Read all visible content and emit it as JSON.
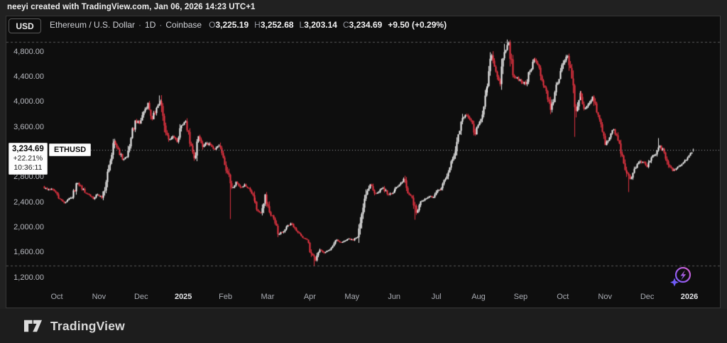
{
  "attribution": {
    "text": "neeyi created with TradingView.com, Jan 06, 2026 14:23 UTC+1"
  },
  "toolbar": {
    "currency_button": "USD"
  },
  "legend": {
    "symbol_title": "Ethereum / U.S. Dollar",
    "sep": "·",
    "interval": "1D",
    "exchange": "Coinbase",
    "ohlc": [
      {
        "label": "O",
        "value": "3,225.19"
      },
      {
        "label": "H",
        "value": "3,252.68"
      },
      {
        "label": "L",
        "value": "3,203.14"
      },
      {
        "label": "C",
        "value": "3,234.69"
      }
    ],
    "change": "+9.50 (+0.29%)"
  },
  "price_tag": {
    "price": "3,234.69",
    "change_percent": "+22.21%",
    "countdown": "10:36:11",
    "symbol": "ETHUSD"
  },
  "footer": {
    "brand": "TradingView"
  },
  "icons": {
    "bottom_right": "lightning-boost-icon",
    "footer_left": "tradingview-logo-icon"
  },
  "colors": {
    "up": "#ffffff",
    "down": "#f23645",
    "pane_bg": "#0e0e0e",
    "pane_border": "#363636",
    "level_line": "rgba(150,150,152,0.55)",
    "price_line": "rgba(185,185,190,0.85)",
    "accent_purple": "#7a5cff",
    "accent_magenta": "#c157c1"
  },
  "chart_data": {
    "type": "candlestick",
    "symbol": "ETHUSD",
    "interval": "1D",
    "exchange": "Coinbase",
    "x_axis": {
      "labels": [
        "Oct",
        "Nov",
        "Dec",
        "2025",
        "Feb",
        "Mar",
        "Apr",
        "May",
        "Jun",
        "Jul",
        "Aug",
        "Sep",
        "Oct",
        "Nov",
        "Dec",
        "2026"
      ]
    },
    "y_axis": {
      "ticks": [
        {
          "value": 4800,
          "label": "4,800.00"
        },
        {
          "value": 4400,
          "label": "4,400.00"
        },
        {
          "value": 4000,
          "label": "4,000.00"
        },
        {
          "value": 3600,
          "label": "3,600.00"
        },
        {
          "value": 2800,
          "label": "2,800.00"
        },
        {
          "value": 2400,
          "label": "2,400.00"
        },
        {
          "value": 2000,
          "label": "2,000.00"
        },
        {
          "value": 1600,
          "label": "1,600.00"
        },
        {
          "value": 1200,
          "label": "1,200.00"
        }
      ],
      "hidden_tick_behind_label": 3200
    },
    "levels": {
      "high_dashed_line": 4955,
      "low_dashed_line": 1385,
      "last_price_line": 3234.69
    },
    "last": {
      "open": 3225.19,
      "high": 3252.68,
      "low": 3203.14,
      "close": 3234.69,
      "change": 9.5,
      "change_pct": 0.29
    },
    "points_per_month": 10,
    "close_path": [
      2650,
      2600,
      2610,
      2560,
      2450,
      2390,
      2440,
      2470,
      2700,
      2660,
      2550,
      2520,
      2450,
      2520,
      2470,
      2720,
      3060,
      3370,
      3240,
      3080,
      3120,
      3420,
      3700,
      3650,
      3840,
      3980,
      3720,
      3900,
      4010,
      3620,
      3400,
      3450,
      3360,
      3620,
      3690,
      3330,
      3100,
      3450,
      3280,
      3340,
      3310,
      3240,
      3300,
      3110,
      2870,
      2630,
      2720,
      2640,
      2680,
      2620,
      2510,
      2280,
      2230,
      2520,
      2240,
      2140,
      1890,
      1920,
      2010,
      2060,
      1980,
      1900,
      1830,
      1800,
      1580,
      1470,
      1640,
      1590,
      1630,
      1700,
      1800,
      1760,
      1790,
      1820,
      1790,
      1840,
      2210,
      2520,
      2680,
      2540,
      2560,
      2630,
      2530,
      2530,
      2620,
      2680,
      2770,
      2540,
      2470,
      2230,
      2410,
      2450,
      2490,
      2480,
      2590,
      2620,
      2770,
      2950,
      3140,
      3480,
      3740,
      3780,
      3700,
      3480,
      3680,
      3920,
      4250,
      4740,
      4480,
      4280,
      4790,
      4940,
      4420,
      4390,
      4310,
      4280,
      4490,
      4680,
      4590,
      4340,
      4170,
      3870,
      4150,
      4360,
      4620,
      4730,
      4370,
      3850,
      4140,
      3890,
      3960,
      4080,
      3830,
      3640,
      3310,
      3430,
      3560,
      3380,
      3140,
      2870,
      2770,
      2930,
      3030,
      3040,
      2960,
      3110,
      3160,
      3300,
      3190,
      2990,
      2900,
      2940,
      2990,
      3060,
      3140,
      3234.69
    ],
    "wick_events": [
      {
        "index": 28,
        "high": 4100
      },
      {
        "index": 45,
        "low": 2130
      },
      {
        "index": 65,
        "low": 1385
      },
      {
        "index": 89,
        "low": 2120
      },
      {
        "index": 111,
        "high": 4990
      },
      {
        "index": 127,
        "low": 3440
      },
      {
        "index": 140,
        "low": 2560
      },
      {
        "index": 147,
        "high": 3420
      }
    ]
  }
}
